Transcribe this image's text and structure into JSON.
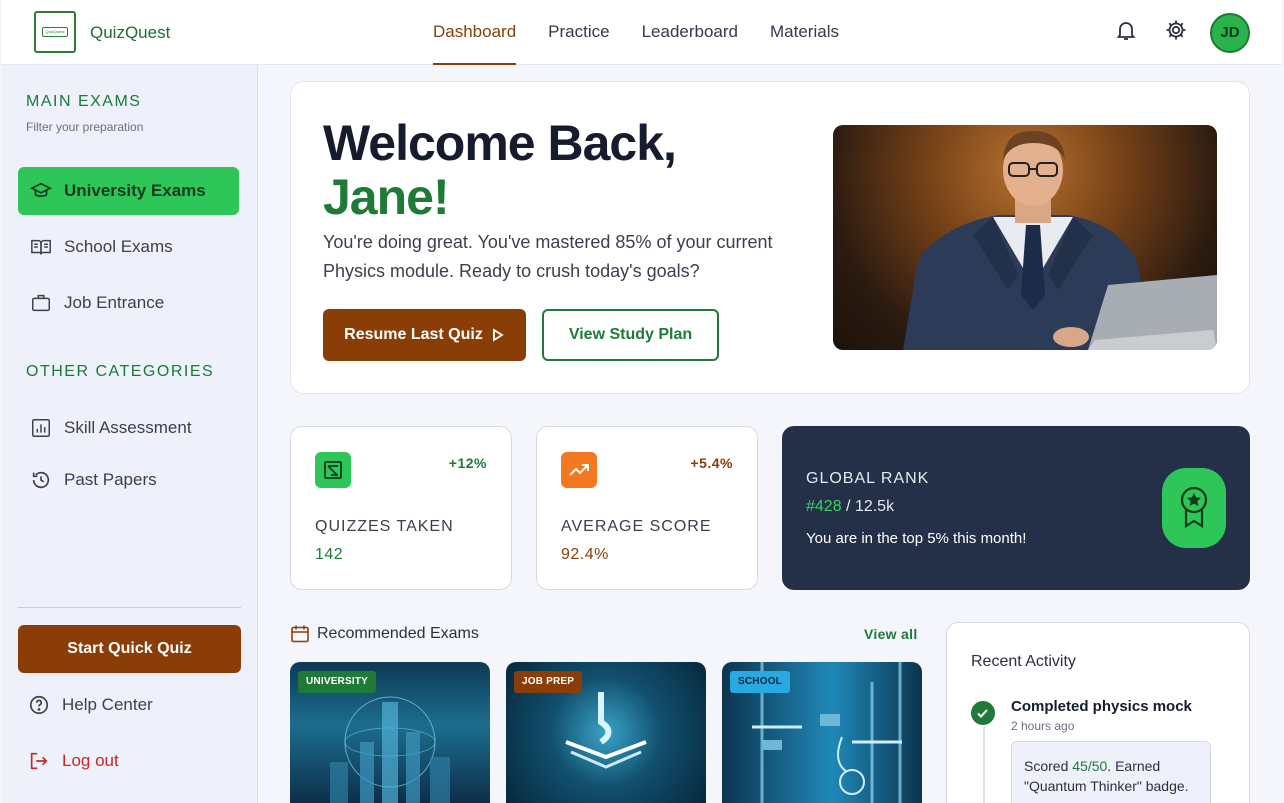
{
  "header": {
    "brand": "QuizQuest",
    "logo_text": "QuizQuest",
    "nav": [
      "Dashboard",
      "Practice",
      "Leaderboard",
      "Materials"
    ],
    "active_nav": "Dashboard",
    "avatar_initials": "JD"
  },
  "sidebar": {
    "main_title": "MAIN EXAMS",
    "main_subtitle": "Filter your preparation",
    "main_items": [
      {
        "label": "University Exams",
        "icon": "graduation-cap-icon",
        "active": true
      },
      {
        "label": "School Exams",
        "icon": "book-open-icon",
        "active": false
      },
      {
        "label": "Job Entrance",
        "icon": "briefcase-icon",
        "active": false
      }
    ],
    "other_title": "OTHER CATEGORIES",
    "other_items": [
      {
        "label": "Skill Assessment",
        "icon": "bar-chart-icon"
      },
      {
        "label": "Past Papers",
        "icon": "history-icon"
      }
    ],
    "quick_quiz_label": "Start Quick Quiz",
    "help_label": "Help Center",
    "logout_label": "Log out"
  },
  "hero": {
    "title": "Welcome Back,",
    "name": "Jane!",
    "text": "You're doing great. You've mastered 85% of your current Physics module. Ready to crush today's goals?",
    "primary_label": "Resume Last Quiz",
    "secondary_label": "View Study Plan"
  },
  "stats": {
    "quizzes": {
      "label": "QUIZZES TAKEN",
      "value": "142",
      "delta": "+12%"
    },
    "average": {
      "label": "AVERAGE SCORE",
      "value": "92.4%",
      "delta": "+5.4%"
    },
    "rank": {
      "label": "GLOBAL RANK",
      "position": "#428",
      "total": "/ 12.5k",
      "message": "You are in the top 5% this month!"
    }
  },
  "recommended": {
    "title": "Recommended Exams",
    "view_all": "View all",
    "cards": [
      {
        "tag": "UNIVERSITY"
      },
      {
        "tag": "JOB PREP"
      },
      {
        "tag": "SCHOOL"
      }
    ]
  },
  "activity": {
    "title": "Recent Activity",
    "item_title": "Completed physics mock",
    "item_time": "2 hours ago",
    "detail_prefix": "Scored ",
    "detail_score": "45/50",
    "detail_suffix": ". Earned \"Quantum Thinker\" badge."
  },
  "colors": {
    "brand_green": "#1f7a38",
    "accent_green": "#2ec659",
    "brown": "#8b3d08",
    "navy": "#233048"
  }
}
